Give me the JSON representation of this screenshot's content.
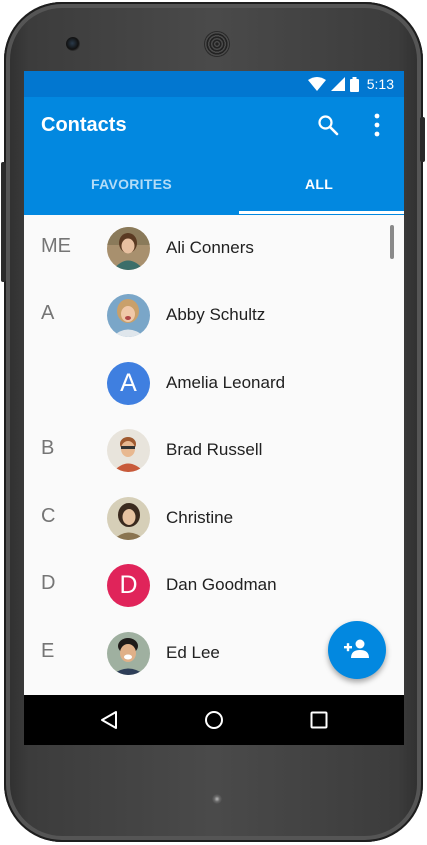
{
  "status_bar": {
    "time": "5:13",
    "icons": [
      "wifi-icon",
      "signal-icon",
      "battery-icon"
    ]
  },
  "app_bar": {
    "title": "Contacts",
    "actions": [
      "search-icon",
      "more-vert-icon"
    ]
  },
  "tabs": [
    {
      "label": "FAVORITES",
      "selected": false
    },
    {
      "label": "ALL",
      "selected": true
    }
  ],
  "contacts": [
    {
      "section": "ME",
      "name": "Ali Conners",
      "avatar": "photo"
    },
    {
      "section": "A",
      "name": "Abby Schultz",
      "avatar": "photo"
    },
    {
      "section": "",
      "name": "Amelia Leonard",
      "avatar": "initial",
      "initial": "A",
      "color": "#3f7fe0"
    },
    {
      "section": "B",
      "name": "Brad Russell",
      "avatar": "photo"
    },
    {
      "section": "C",
      "name": "Christine",
      "avatar": "photo"
    },
    {
      "section": "D",
      "name": "Dan Goodman",
      "avatar": "initial",
      "initial": "D",
      "color": "#e0245a"
    },
    {
      "section": "E",
      "name": "Ed Lee",
      "avatar": "photo"
    }
  ],
  "fab": {
    "icon": "add-person-icon"
  },
  "nav_bar": {
    "icons": [
      "back-icon",
      "home-icon",
      "recents-icon"
    ]
  },
  "colors": {
    "primary": "#0288e0",
    "status_bar": "#0277d0",
    "tab_inactive": "#b3dcf7"
  }
}
